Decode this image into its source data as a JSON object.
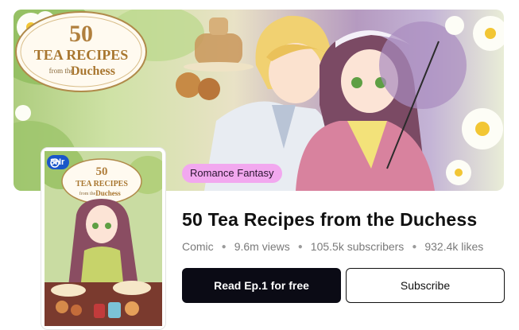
{
  "banner": {
    "logo": {
      "number": "50",
      "line1": "TEA RECIPES",
      "line2": "from the",
      "line3": "Duchess"
    },
    "genre": "Romance Fantasy"
  },
  "cover": {
    "badge": "3Hr",
    "logo": {
      "number": "50",
      "line1": "TEA RECIPES",
      "line2": "from the",
      "line3": "Duchess"
    }
  },
  "series": {
    "title": "50 Tea Recipes from the Duchess",
    "type": "Comic",
    "views": "9.6m views",
    "subscribers": "105.5k subscribers",
    "likes": "932.4k likes"
  },
  "actions": {
    "read": "Read Ep.1 for free",
    "subscribe": "Subscribe"
  },
  "colors": {
    "genre_pill": "#f2a8ef",
    "read_button": "#0b0b15",
    "time_badge": "#1a56c9"
  }
}
